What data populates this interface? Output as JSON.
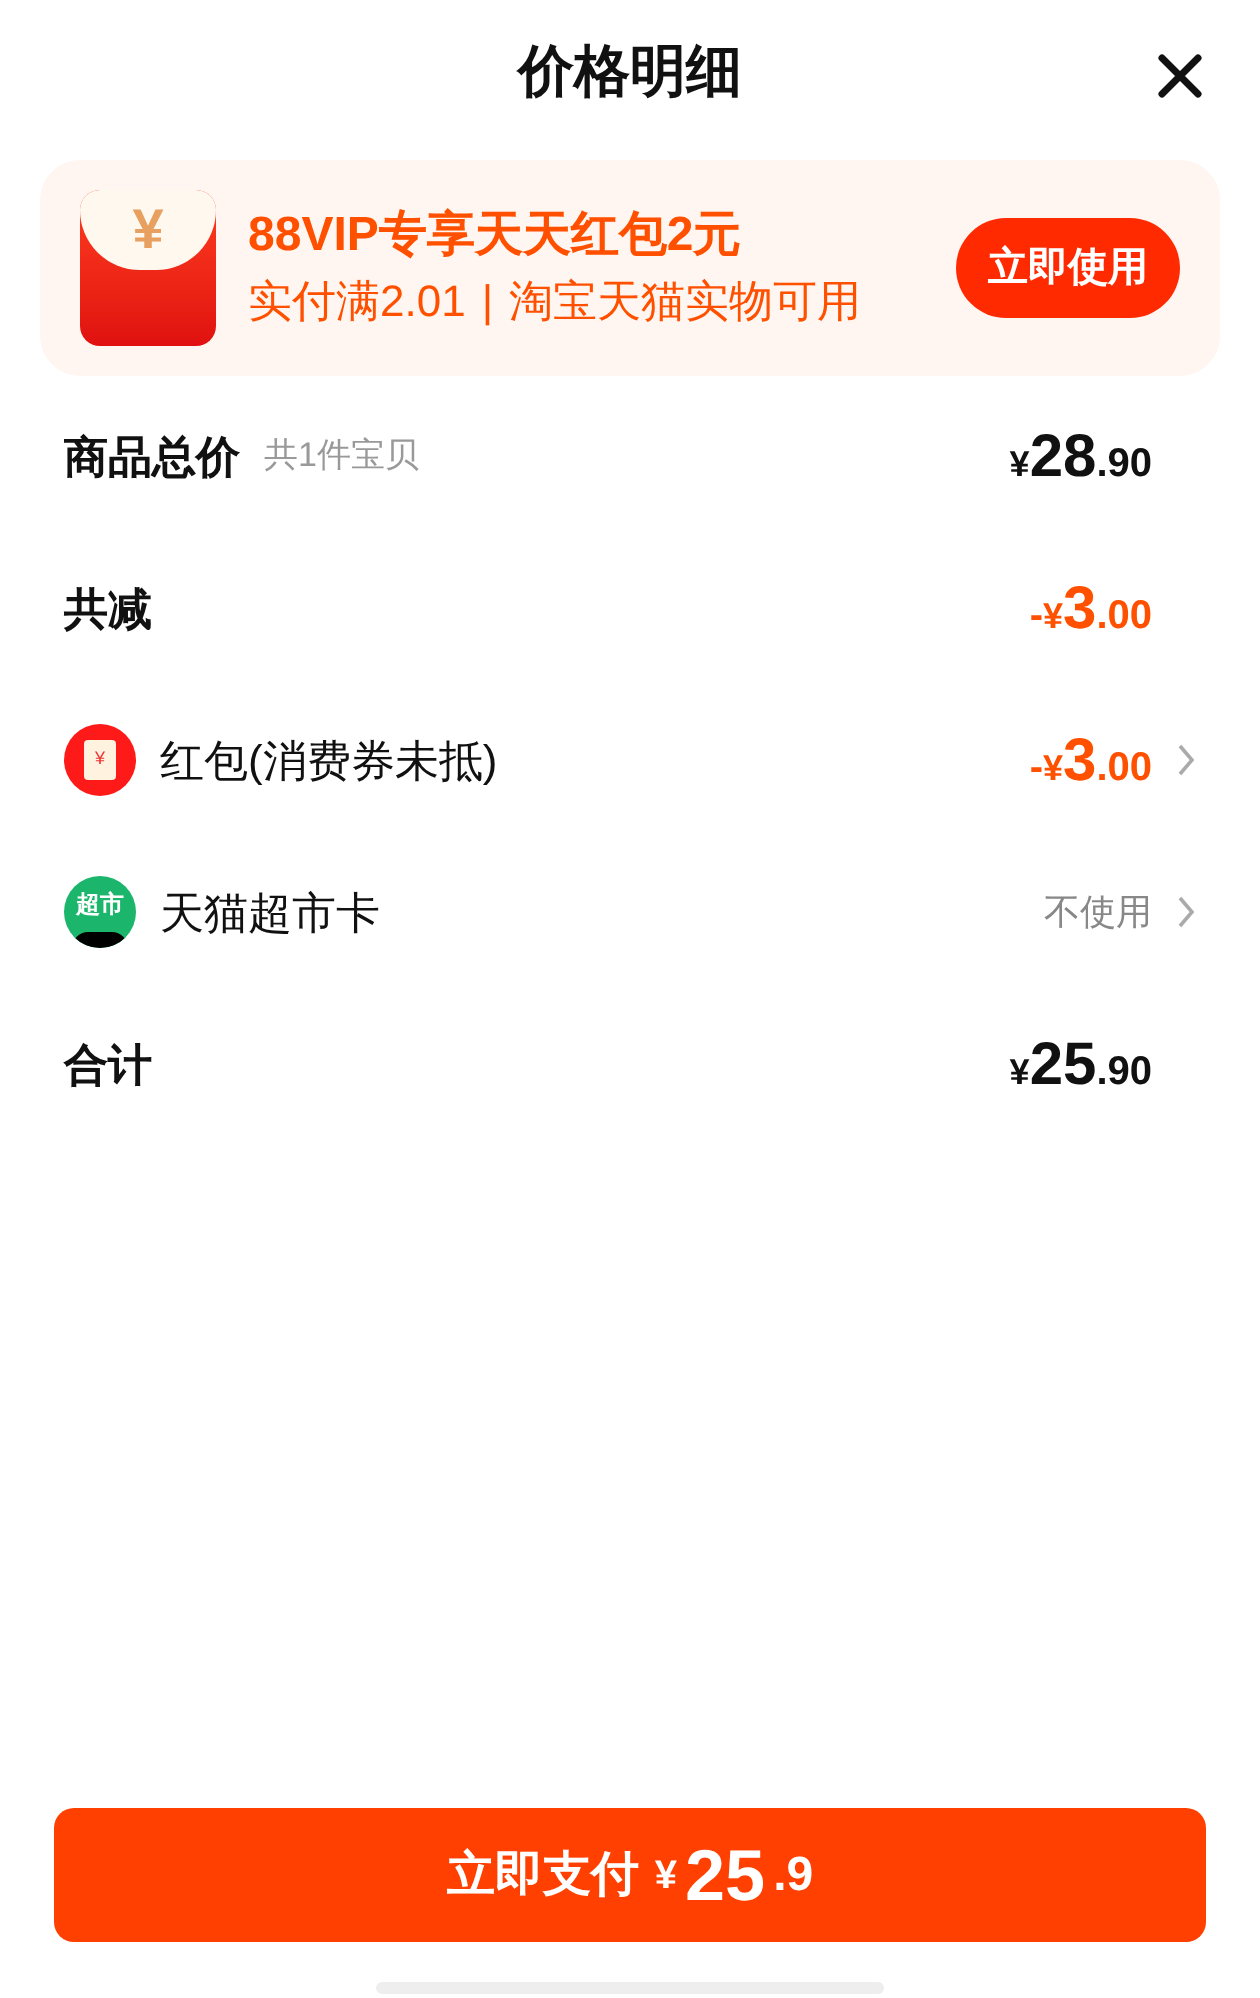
{
  "title": "价格明细",
  "promo": {
    "title": "88VIP专享天天红包2元",
    "condition": "实付满2.01",
    "separator": "|",
    "scope": "淘宝天猫实物可用",
    "icon_glyph": "¥",
    "button": "立即使用"
  },
  "rows": [
    {
      "kind": "price",
      "label": "商品总价",
      "note": "共1件宝贝",
      "price": {
        "currency": "¥",
        "integer": "28",
        "decimal": ".90"
      },
      "highlight": false
    },
    {
      "kind": "price",
      "label": "共减",
      "price": {
        "sign": "-",
        "currency": "¥",
        "integer": "3",
        "decimal": ".00"
      },
      "highlight": true
    },
    {
      "kind": "redpacket",
      "label": "红包(消费券未抵)",
      "icon_glyph": "¥",
      "price": {
        "sign": "-",
        "currency": "¥",
        "integer": "3",
        "decimal": ".00"
      },
      "highlight": true
    },
    {
      "kind": "card",
      "label": "天猫超市卡",
      "icon_glyph": "超市",
      "value": "不使用"
    },
    {
      "kind": "price",
      "label": "合计",
      "price": {
        "currency": "¥",
        "integer": "25",
        "decimal": ".90"
      },
      "highlight": false
    }
  ],
  "pay_button": {
    "label": "立即支付",
    "currency": "¥",
    "integer": "25",
    "decimal": ".9"
  }
}
